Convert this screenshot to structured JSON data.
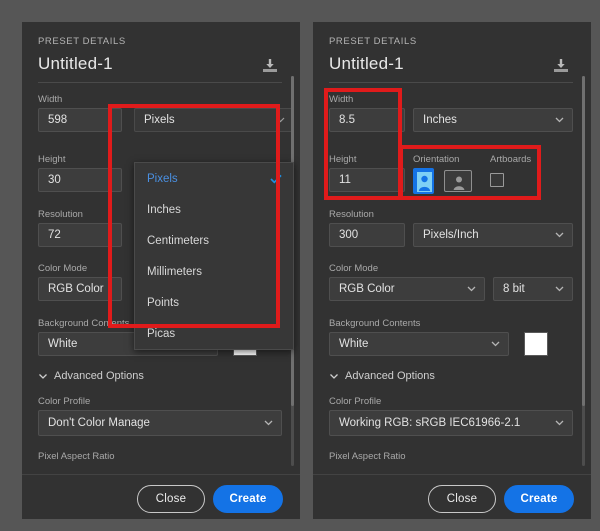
{
  "meta": {
    "accent_blue": "#1473e6",
    "annotation_red": "#e01b1b",
    "panel_bg": "#323232",
    "page_bg": "#565656"
  },
  "left_panel": {
    "header": {
      "section_label": "PRESET DETAILS",
      "document_name": "Untitled-1",
      "save_preset_icon": "save-preset-icon"
    },
    "width": {
      "label": "Width",
      "value": "598"
    },
    "units": {
      "selected": "Pixels"
    },
    "height": {
      "label": "Height",
      "value": "30"
    },
    "resolution": {
      "label": "Resolution",
      "value": "72"
    },
    "color_mode": {
      "label": "Color Mode",
      "value": "RGB Color"
    },
    "background_contents": {
      "label": "Background Contents",
      "value": "White",
      "swatch_color": "#ffffff"
    },
    "advanced_options": {
      "label": "Advanced Options",
      "expanded": true
    },
    "color_profile": {
      "label": "Color Profile",
      "value": "Don't Color Manage"
    },
    "pixel_aspect_ratio": {
      "label": "Pixel Aspect Ratio"
    },
    "buttons": {
      "close": "Close",
      "create": "Create"
    },
    "unit_dropdown": {
      "open": true,
      "options": [
        {
          "label": "Pixels",
          "selected": true
        },
        {
          "label": "Inches",
          "selected": false
        },
        {
          "label": "Centimeters",
          "selected": false
        },
        {
          "label": "Millimeters",
          "selected": false
        },
        {
          "label": "Points",
          "selected": false
        },
        {
          "label": "Picas",
          "selected": false
        }
      ]
    }
  },
  "right_panel": {
    "header": {
      "section_label": "PRESET DETAILS",
      "document_name": "Untitled-1",
      "save_preset_icon": "save-preset-icon"
    },
    "width": {
      "label": "Width",
      "value": "8.5"
    },
    "units": {
      "selected": "Inches"
    },
    "height": {
      "label": "Height",
      "value": "11"
    },
    "orientation": {
      "label": "Orientation",
      "portrait_selected": true,
      "landscape_selected": false
    },
    "artboards": {
      "label": "Artboards",
      "checked": false
    },
    "resolution": {
      "label": "Resolution",
      "value": "300",
      "unit": "Pixels/Inch"
    },
    "color_mode": {
      "label": "Color Mode",
      "value": "RGB Color",
      "depth": "8 bit"
    },
    "background_contents": {
      "label": "Background Contents",
      "value": "White",
      "swatch_color": "#ffffff"
    },
    "advanced_options": {
      "label": "Advanced Options",
      "expanded": true
    },
    "color_profile": {
      "label": "Color Profile",
      "value": "Working RGB: sRGB IEC61966-2.1"
    },
    "pixel_aspect_ratio": {
      "label": "Pixel Aspect Ratio"
    },
    "buttons": {
      "close": "Close",
      "create": "Create"
    }
  }
}
